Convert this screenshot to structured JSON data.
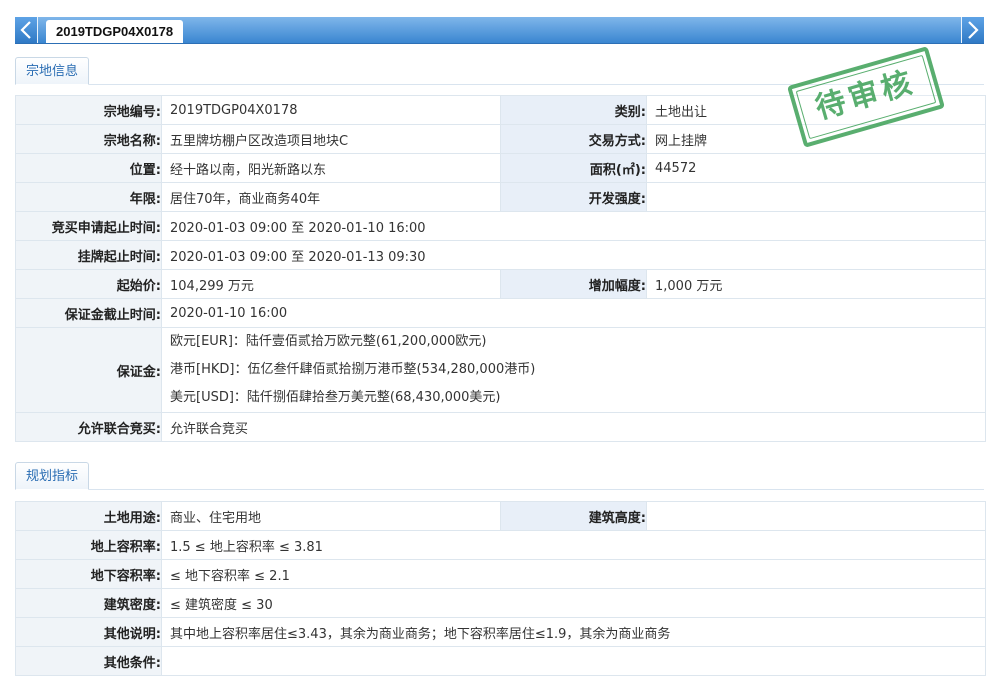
{
  "tab": {
    "title": "2019TDGP04X0178"
  },
  "section1": {
    "title": "宗地信息",
    "rows": {
      "parcel_no_label": "宗地编号:",
      "parcel_no": "2019TDGP04X0178",
      "category_label": "类别:",
      "category": "土地出让",
      "parcel_name_label": "宗地名称:",
      "parcel_name": "五里牌坊棚户区改造项目地块C",
      "trade_mode_label": "交易方式:",
      "trade_mode": "网上挂牌",
      "location_label": "位置:",
      "location": "经十路以南，阳光新路以东",
      "area_label": "面积(㎡):",
      "area": "44572",
      "term_label": "年限:",
      "term": "居住70年，商业商务40年",
      "intensity_label": "开发强度:",
      "intensity": "",
      "apply_period_label": "竞买申请起止时间:",
      "apply_period": "2020-01-03 09:00 至 2020-01-10 16:00",
      "listing_period_label": "挂牌起止时间:",
      "listing_period": "2020-01-03 09:00 至 2020-01-13 09:30",
      "start_price_label": "起始价:",
      "start_price": "104,299 万元",
      "increment_label": "增加幅度:",
      "increment": "1,000 万元",
      "deposit_deadline_label": "保证金截止时间:",
      "deposit_deadline": "2020-01-10 16:00",
      "deposit_label": "保证金:",
      "deposit_eur": "欧元[EUR]：陆仟壹佰贰拾万欧元整(61,200,000欧元)",
      "deposit_hkd": "港币[HKD]：伍亿叁仟肆佰贰拾捌万港币整(534,280,000港币)",
      "deposit_usd": "美元[USD]：陆仟捌佰肆拾叁万美元整(68,430,000美元)",
      "joint_label": "允许联合竞买:",
      "joint": "允许联合竞买"
    }
  },
  "section2": {
    "title": "规划指标",
    "rows": {
      "land_use_label": "土地用途:",
      "land_use": "商业、住宅用地",
      "height_label": "建筑高度:",
      "height": "",
      "far_above_label": "地上容积率:",
      "far_above": "1.5 ≤ 地上容积率 ≤ 3.81",
      "far_below_label": "地下容积率:",
      "far_below": "≤ 地下容积率 ≤ 2.1",
      "density_label": "建筑密度:",
      "density": "≤ 建筑密度 ≤ 30",
      "notes_label": "其他说明:",
      "notes": "其中地上容积率居住≤3.43，其余为商业商务；地下容积率居住≤1.9，其余为商业商务",
      "other_label": "其他条件:",
      "other": ""
    }
  },
  "stamp": {
    "text": "待审核",
    "color": "#3da156"
  },
  "colors": {
    "accent": "#3a86d1",
    "label_bg": "#f0f4f8",
    "section_text": "#2a6db3"
  }
}
